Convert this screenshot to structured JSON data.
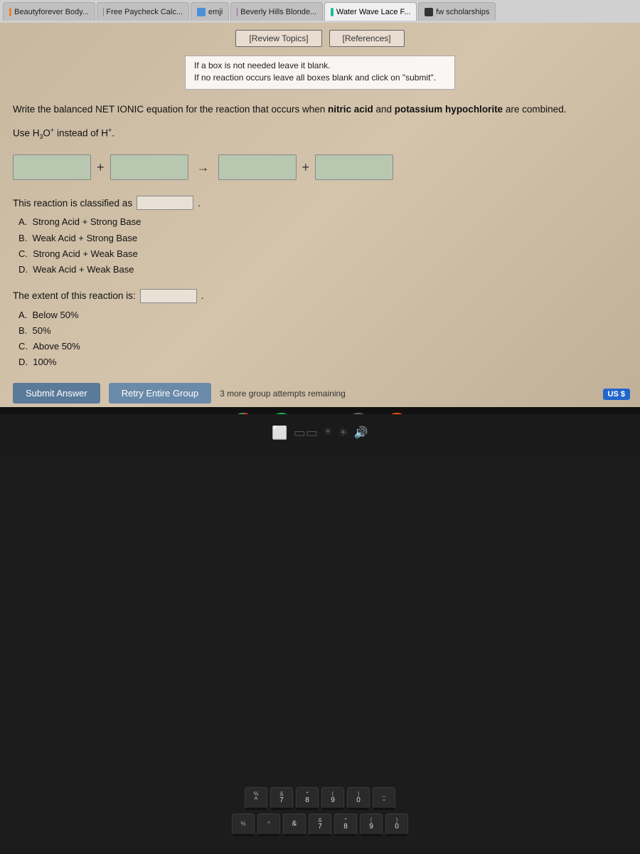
{
  "tabs": [
    {
      "id": "tab1",
      "label": "Beautyforever Body...",
      "favicon": "orange",
      "active": false
    },
    {
      "id": "tab2",
      "label": "Free Paycheck Calc...",
      "favicon": "gray",
      "active": false
    },
    {
      "id": "tab3",
      "label": "emji",
      "favicon": "blue",
      "active": false
    },
    {
      "id": "tab4",
      "label": "Beverly Hills Blonde...",
      "favicon": "purple",
      "active": false
    },
    {
      "id": "tab5",
      "label": "Water Wave Lace F...",
      "favicon": "teal",
      "active": true
    },
    {
      "id": "tab6",
      "label": "fw scholarships",
      "favicon": "dark",
      "active": false
    }
  ],
  "question_tabs": [
    {
      "id": "review",
      "label": "[Review Topics]"
    },
    {
      "id": "references",
      "label": "[References]"
    }
  ],
  "instructions": [
    "If a box is not needed leave it blank.",
    "If no reaction occurs leave all boxes blank and click on \"submit\"."
  ],
  "question_text": "Write the balanced NET IONIC equation for the reaction that occurs when nitric acid and potassium hypochlorite are combined.",
  "use_h3o": "Use H₃O⁺ instead of H⁺.",
  "classification": {
    "label": "This reaction is classified as",
    "options": [
      {
        "id": "A",
        "text": "Strong Acid + Strong Base"
      },
      {
        "id": "B",
        "text": "Weak Acid + Strong Base"
      },
      {
        "id": "C",
        "text": "Strong Acid + Weak Base"
      },
      {
        "id": "D",
        "text": "Weak Acid + Weak Base"
      }
    ]
  },
  "extent": {
    "label": "The extent of this reaction is:",
    "options": [
      {
        "id": "A",
        "text": "Below 50%"
      },
      {
        "id": "B",
        "text": "50%"
      },
      {
        "id": "C",
        "text": "Above 50%"
      },
      {
        "id": "D",
        "text": "100%"
      }
    ]
  },
  "buttons": {
    "submit": "Submit Answer",
    "retry": "Retry Entire Group",
    "attempts": "3 more group attempts remaining"
  },
  "us_badge": "US $",
  "taskbar": {
    "icons": [
      "chrome",
      "spotify",
      "drive",
      "user",
      "play"
    ]
  },
  "keyboard": {
    "rows": [
      [
        "%",
        "^",
        "&",
        "*",
        "(",
        ")",
        "-"
      ],
      [
        "7",
        "8",
        "9",
        "0"
      ]
    ]
  },
  "system_right": {
    "volume": "🔊",
    "label": "US"
  }
}
